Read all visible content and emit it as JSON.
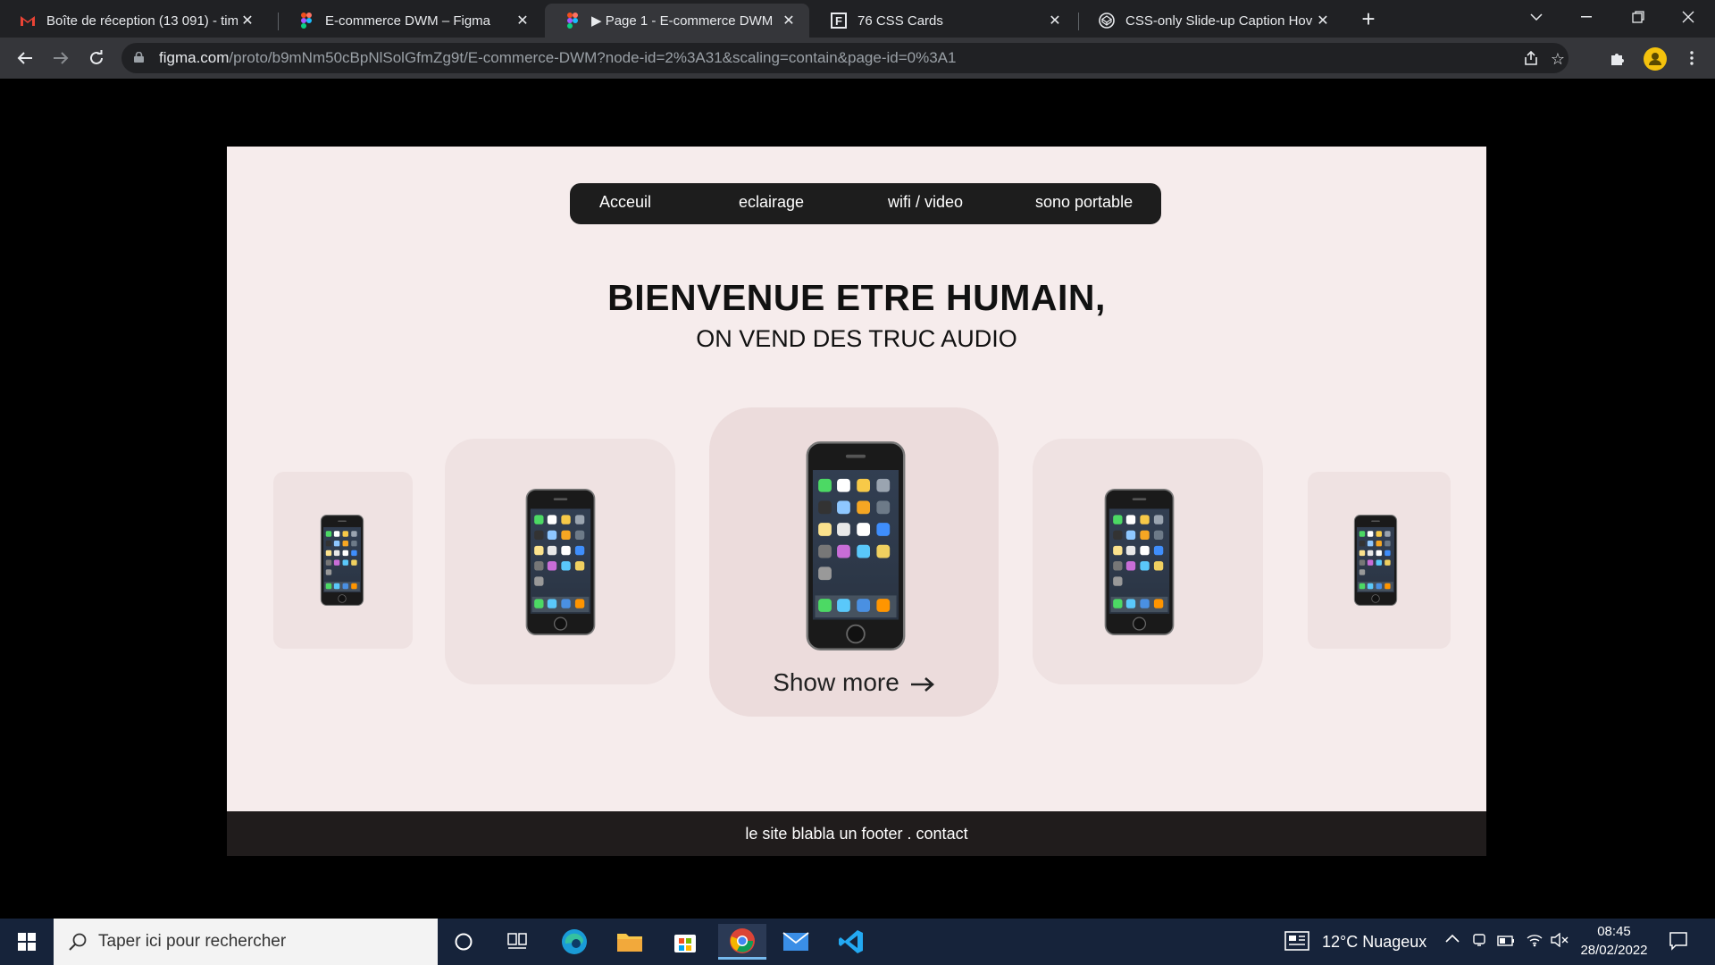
{
  "browser": {
    "tabs": [
      {
        "title": "Boîte de réception (13 091) - tim...",
        "icon": "gmail-icon"
      },
      {
        "title": "E-commerce DWM – Figma",
        "icon": "figma-icon"
      },
      {
        "title": "▶ Page 1 - E-commerce DWM",
        "icon": "figma-icon",
        "active": true
      },
      {
        "title": "76 CSS Cards",
        "icon": "f-logo-icon"
      },
      {
        "title": "CSS-only Slide-up Caption Hover",
        "icon": "codepen-icon"
      }
    ],
    "close_glyph": "✕",
    "new_tab_glyph": "+",
    "url_host": "figma.com",
    "url_path": "/proto/b9mNm50cBpNlSolGfmZg9t/E-commerce-DWM?node-id=2%3A31&scaling=contain&page-id=0%3A1"
  },
  "site": {
    "nav": [
      "Acceuil",
      "eclairage",
      "wifi / video",
      "sono portable"
    ],
    "title": "BIENVENUE ETRE HUMAIN,",
    "subtitle": "ON VEND DES TRUC AUDIO",
    "show_more": "Show more",
    "footer": "le site blabla un footer . contact"
  },
  "taskbar": {
    "search_placeholder": "Taper ici pour rechercher",
    "weather": "12°C  Nuageux",
    "time": "08:45",
    "date": "28/02/2022"
  }
}
